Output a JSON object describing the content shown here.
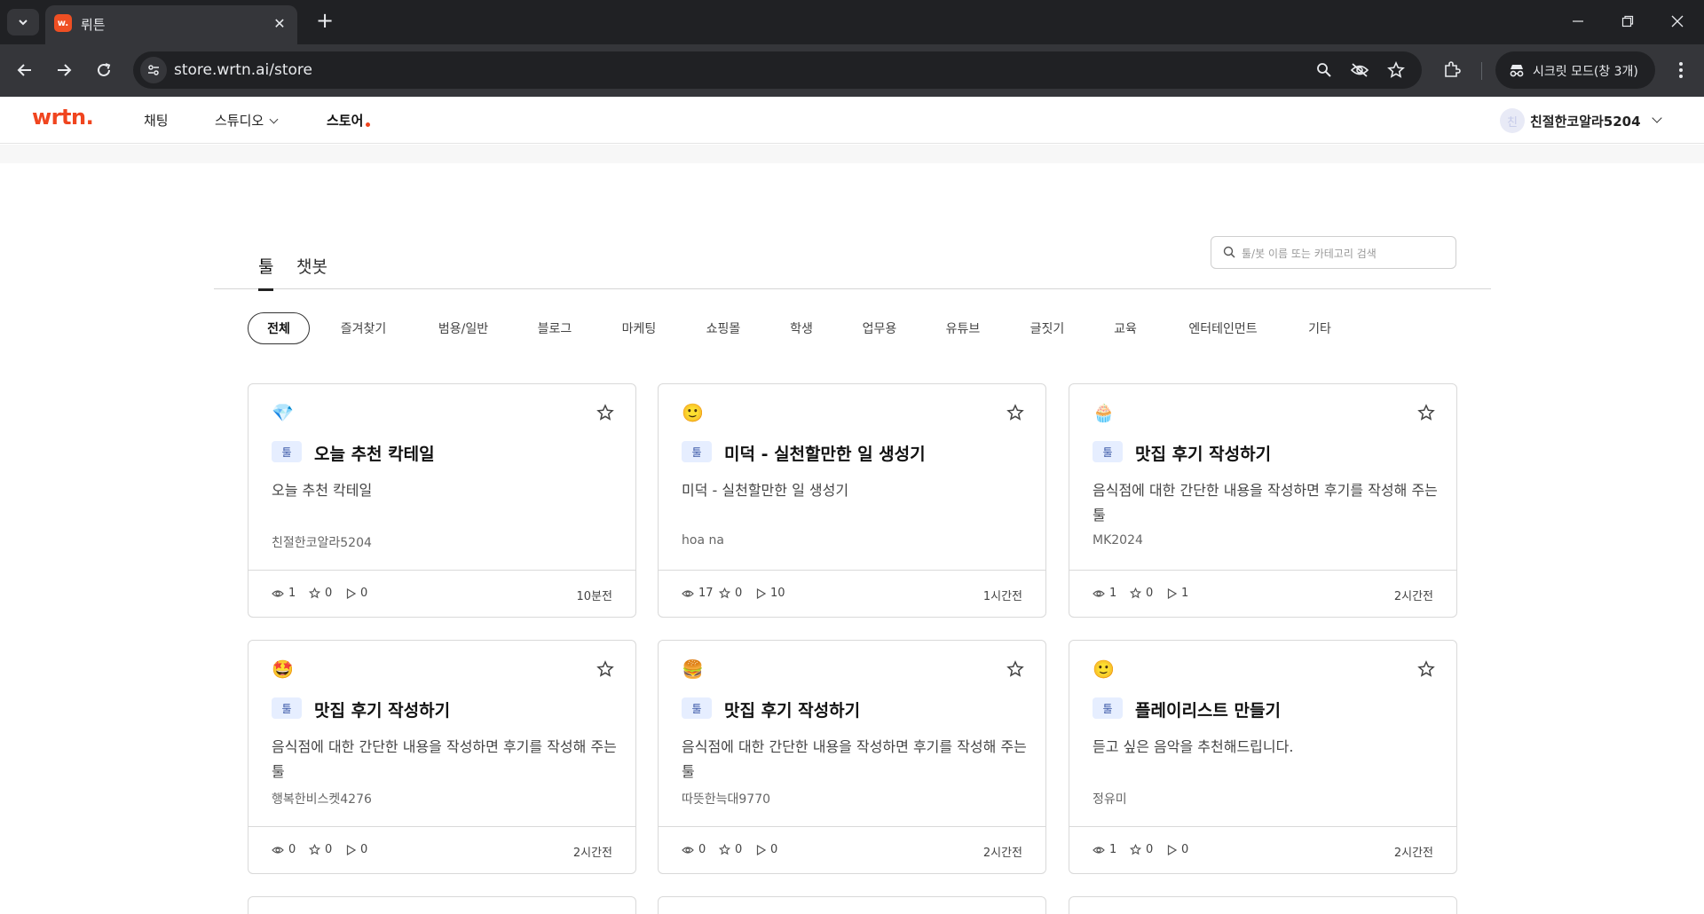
{
  "browser": {
    "tab_title": "뤼튼",
    "tab_favicon": "w.",
    "url": "store.wrtn.ai/store",
    "incognito_label": "시크릿 모드(창 3개)"
  },
  "header": {
    "logo": "wrtn.",
    "nav": [
      {
        "label": "채팅"
      },
      {
        "label": "스튜디오"
      },
      {
        "label": "스토어"
      }
    ],
    "user": {
      "avatar": "친",
      "name": "친절한코알라5204"
    }
  },
  "store": {
    "tabs": [
      {
        "label": "툴"
      },
      {
        "label": "챗봇"
      }
    ],
    "search_placeholder": "툴/봇 이름 또는 카테고리 검색",
    "categories": [
      "전체",
      "즐겨찾기",
      "범용/일반",
      "블로그",
      "마케팅",
      "쇼핑몰",
      "학생",
      "업무용",
      "유튜브",
      "글짓기",
      "교육",
      "엔터테인먼트",
      "기타"
    ],
    "cards": [
      {
        "emoji": "💎",
        "badge": "툴",
        "title": "오늘 추천 칵테일",
        "desc": "오늘 추천 칵테일",
        "author": "친절한코알라5204",
        "views": "1",
        "stars": "0",
        "runs": "0",
        "time": "10분전"
      },
      {
        "emoji": "🙂",
        "badge": "툴",
        "title": "미덕 - 실천할만한 일 생성기",
        "desc": "미덕 - 실천할만한 일 생성기",
        "author": "hoa na",
        "views": "17",
        "stars": "0",
        "runs": "10",
        "time": "1시간전"
      },
      {
        "emoji": "🧁",
        "badge": "툴",
        "title": "맛집 후기 작성하기",
        "desc": "음식점에 대한 간단한 내용을 작성하면 후기를 작성해 주는 툴",
        "author": "MK2024",
        "views": "1",
        "stars": "0",
        "runs": "1",
        "time": "2시간전"
      },
      {
        "emoji": "🤩",
        "badge": "툴",
        "title": "맛집 후기 작성하기",
        "desc": "음식점에 대한 간단한 내용을 작성하면 후기를 작성해 주는 툴",
        "author": "행복한비스켓4276",
        "views": "0",
        "stars": "0",
        "runs": "0",
        "time": "2시간전"
      },
      {
        "emoji": "🍔",
        "badge": "툴",
        "title": "맛집 후기 작성하기",
        "desc": "음식점에 대한 간단한 내용을 작성하면 후기를 작성해 주는 툴",
        "author": "따뜻한늑대9770",
        "views": "0",
        "stars": "0",
        "runs": "0",
        "time": "2시간전"
      },
      {
        "emoji": "🙂",
        "badge": "툴",
        "title": "플레이리스트 만들기",
        "desc": "듣고 싶은 음악을 추천해드립니다.",
        "author": "정유미",
        "views": "1",
        "stars": "0",
        "runs": "0",
        "time": "2시간전"
      }
    ]
  },
  "icons": {
    "tab_search": "chevron-down-icon",
    "back": "arrow-left-icon",
    "forward": "arrow-right-icon",
    "reload": "reload-icon",
    "site_info": "tune-icon",
    "zoom": "magnifier-icon",
    "eye_off": "eye-slash-icon",
    "bookmark": "star-icon",
    "extensions": "puzzle-icon",
    "incognito": "incognito-icon",
    "menu": "more-vert-icon"
  },
  "colors": {
    "brand": "#f0451f",
    "badge_bg": "#e6eeff",
    "chrome_dark": "#202124"
  }
}
